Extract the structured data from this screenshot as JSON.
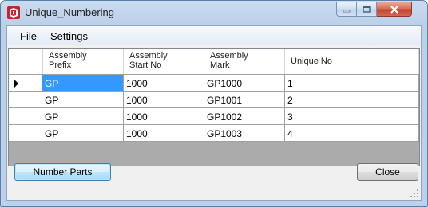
{
  "window": {
    "title": "Unique_Numbering",
    "icon": "app-icon",
    "caption_buttons": [
      "minimize-icon",
      "maximize-icon",
      "close-icon"
    ]
  },
  "menu": {
    "items": [
      {
        "label": "File"
      },
      {
        "label": "Settings"
      }
    ]
  },
  "grid": {
    "columns": [
      {
        "line1": "Assembly",
        "line2": "Prefix"
      },
      {
        "line1": "Assembly",
        "line2": "Start No"
      },
      {
        "line1": "Assembly",
        "line2": "Mark"
      },
      {
        "line1": "Unique No",
        "line2": ""
      }
    ],
    "rows": [
      {
        "prefix": "GP",
        "start_no": "1000",
        "mark": "GP1000",
        "unique_no": "1",
        "current": true
      },
      {
        "prefix": "GP",
        "start_no": "1000",
        "mark": "GP1001",
        "unique_no": "2",
        "current": false
      },
      {
        "prefix": "GP",
        "start_no": "1000",
        "mark": "GP1002",
        "unique_no": "3",
        "current": false
      },
      {
        "prefix": "GP",
        "start_no": "1000",
        "mark": "GP1003",
        "unique_no": "4",
        "current": false
      }
    ]
  },
  "buttons": {
    "number_parts": "Number Parts",
    "close": "Close"
  },
  "colors": {
    "selection": "#3399ff",
    "close_caption": "#c3452e"
  }
}
